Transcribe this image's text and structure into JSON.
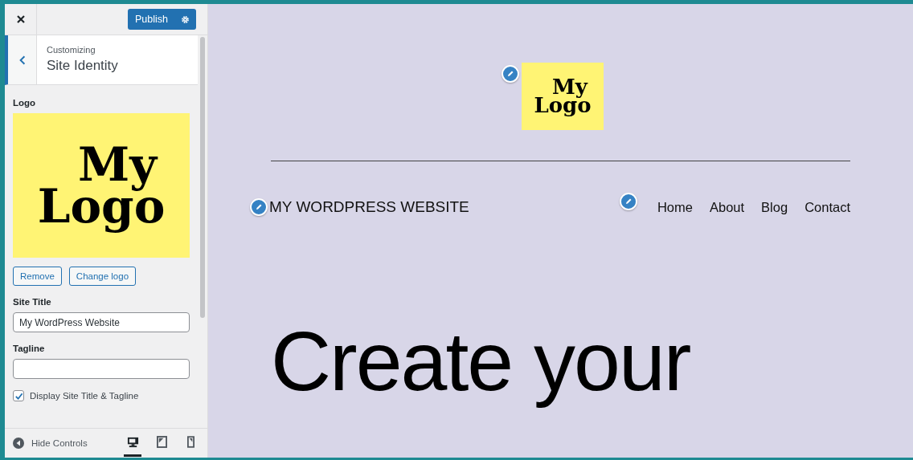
{
  "header": {
    "publish": "Publish"
  },
  "section": {
    "breadcrumb": "Customizing",
    "title": "Site Identity"
  },
  "logo": {
    "label": "Logo",
    "text": [
      "My",
      "Logo"
    ],
    "remove": "Remove",
    "change": "Change logo"
  },
  "site_title": {
    "label": "Site Title",
    "value": "My WordPress Website"
  },
  "tagline": {
    "label": "Tagline"
  },
  "display_title": {
    "label": "Display Site Title & Tagline",
    "checked": true
  },
  "footer": {
    "hide": "Hide Controls",
    "devices": [
      {
        "kind": "desktop",
        "selected": true
      },
      {
        "kind": "tablet",
        "selected": false
      },
      {
        "kind": "mobile",
        "selected": false
      }
    ]
  },
  "preview": {
    "logo_text": [
      "My",
      "Logo"
    ],
    "site_name": "MY WORDPRESS WEBSITE",
    "nav": [
      "Home",
      "About",
      "Blog",
      "Contact"
    ],
    "heading": [
      "Create your"
    ]
  }
}
